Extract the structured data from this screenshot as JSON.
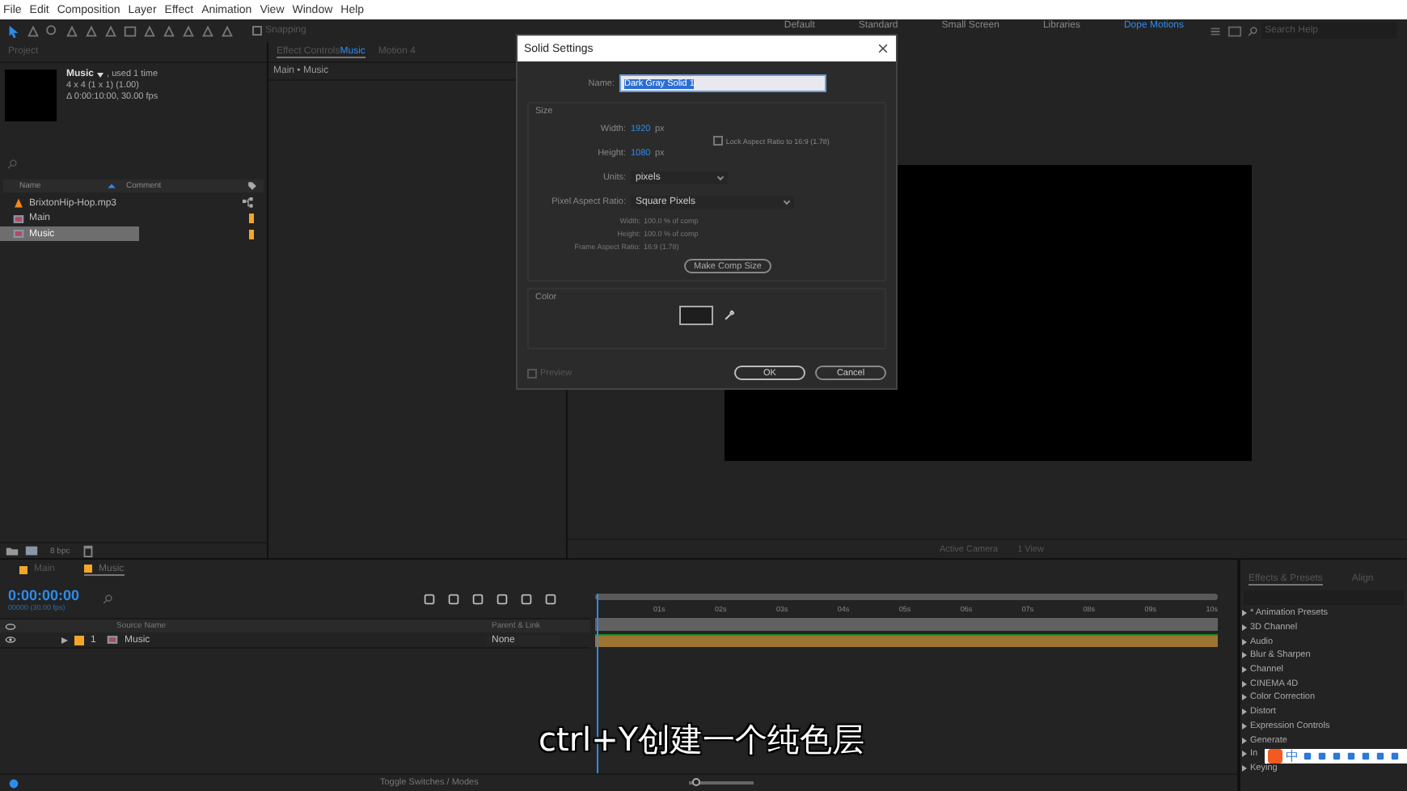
{
  "menu_bar": [
    "File",
    "Edit",
    "Composition",
    "Layer",
    "Effect",
    "Animation",
    "View",
    "Window",
    "Help"
  ],
  "toolbar": {
    "snapping": {
      "label": "Snapping",
      "checked": false
    },
    "workspaces": [
      {
        "label": "Default",
        "selected": false
      },
      {
        "label": "Standard",
        "selected": false
      },
      {
        "label": "Small Screen",
        "selected": false
      },
      {
        "label": "Libraries",
        "selected": false
      },
      {
        "label": "Dope Motions",
        "selected": true
      }
    ],
    "search": {
      "placeholder": "Search Help"
    }
  },
  "project_panel": {
    "tab": "Project",
    "preview": {
      "name": "Music",
      "usage": ", used 1 time",
      "size": "4 x 4  (1 x 1) (1.00)",
      "duration": "Δ 0:00:10:00, 30.00 fps"
    },
    "columns": [
      "Name",
      "Comment"
    ],
    "items": [
      {
        "kind": "audio",
        "name": "BrixtonHip-Hop.mp3",
        "selected": false
      },
      {
        "kind": "composition",
        "name": "Main",
        "selected": false,
        "color": "#f4a629"
      },
      {
        "kind": "composition",
        "name": "Music",
        "selected": true,
        "color": "#f4a629"
      }
    ],
    "bit_depth": "8 bpc"
  },
  "effect_controls": {
    "tabs": [
      {
        "label": "Effect Controls",
        "target": "Music",
        "selected": true
      },
      {
        "label": "Motion 4",
        "selected": false
      }
    ],
    "breadcrumb": "Main • Music"
  },
  "viewer": {
    "toolbar": [
      "Active Camera",
      "1 View"
    ]
  },
  "dialog": {
    "title": "Solid Settings",
    "name_label": "Name:",
    "name_value": "Dark Gray Solid 1",
    "size_heading": "Size",
    "width": {
      "label": "Width:",
      "value": "1920",
      "unit": "px"
    },
    "height": {
      "label": "Height:",
      "value": "1080",
      "unit": "px"
    },
    "lock_aspect": {
      "label": "Lock Aspect Ratio to 16:9 (1.78)",
      "checked": false
    },
    "units": {
      "label": "Units:",
      "value": "pixels"
    },
    "pixel_aspect": {
      "label": "Pixel Aspect Ratio:",
      "value": "Square Pixels"
    },
    "info": [
      {
        "label": "Width:",
        "value": "100.0 % of comp"
      },
      {
        "label": "Height:",
        "value": "100.0 % of comp"
      },
      {
        "label": "Frame Aspect Ratio:",
        "value": "16:9 (1.78)"
      }
    ],
    "make_comp_size": "Make Comp Size",
    "color_heading": "Color",
    "preview": {
      "label": "Preview",
      "checked": false,
      "disabled": true
    },
    "buttons": [
      "OK",
      "Cancel"
    ]
  },
  "timeline": {
    "tabs": [
      {
        "label": "Main",
        "selected": false
      },
      {
        "label": "Music",
        "selected": true
      }
    ],
    "timecode": "0:00:00:00",
    "frame_info": "00000 (30.00 fps)",
    "columns": [
      "Source Name",
      "Parent & Link"
    ],
    "ruler": [
      "01s",
      "02s",
      "03s",
      "04s",
      "05s",
      "06s",
      "07s",
      "08s",
      "09s",
      "10s"
    ],
    "layers": [
      {
        "number": "1",
        "name": "Music",
        "parent": "None",
        "visible": true
      }
    ],
    "footer": "Toggle Switches / Modes",
    "zoom_slider": {
      "level": 0.1
    }
  },
  "effects_panel": {
    "tabs": [
      {
        "label": "Effects & Presets",
        "selected": true
      },
      {
        "label": "Align",
        "selected": false
      }
    ],
    "items": [
      "* Animation Presets",
      "3D Channel",
      "Audio",
      "Blur & Sharpen",
      "Channel",
      "CINEMA 4D",
      "Color Correction",
      "Distort",
      "Expression Controls",
      "Generate",
      "In",
      "Keying"
    ]
  },
  "ime_bar": {
    "mode": "中"
  },
  "subtitle": "ctrl+Y创建一个纯色层"
}
